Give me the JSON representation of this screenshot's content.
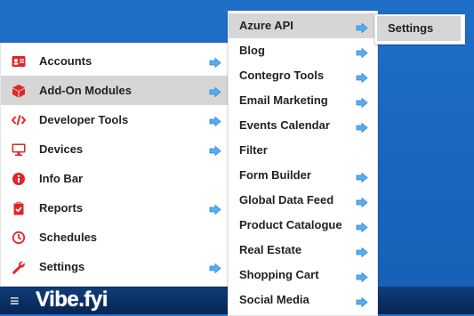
{
  "colors": {
    "desktop": "#1a64bd",
    "bar": "#0a2f63",
    "icon_red": "#e0262a",
    "arrow_blue": "#56aef0",
    "active_bg": "#d6d6d6",
    "text": "#222222"
  },
  "taskbar": {
    "menu_glyph": "≡",
    "logo": "Vibe.fyi"
  },
  "main_menu": [
    {
      "label": "Accounts",
      "icon": "id-card-icon",
      "submenu": true
    },
    {
      "label": "Add-On Modules",
      "icon": "cube-icon",
      "submenu": true,
      "active": true
    },
    {
      "label": "Developer Tools",
      "icon": "code-icon",
      "submenu": true
    },
    {
      "label": "Devices",
      "icon": "monitor-icon",
      "submenu": true
    },
    {
      "label": "Info Bar",
      "icon": "info-circle-icon",
      "submenu": false
    },
    {
      "label": "Reports",
      "icon": "clipboard-check-icon",
      "submenu": true
    },
    {
      "label": "Schedules",
      "icon": "clock-icon",
      "submenu": false
    },
    {
      "label": "Settings",
      "icon": "wrench-icon",
      "submenu": true
    }
  ],
  "addon_menu": [
    {
      "label": "Azure API",
      "submenu": true,
      "active": true
    },
    {
      "label": "Blog",
      "submenu": true
    },
    {
      "label": "Contegro Tools",
      "submenu": true
    },
    {
      "label": "Email Marketing",
      "submenu": true
    },
    {
      "label": "Events Calendar",
      "submenu": true
    },
    {
      "label": "Filter",
      "submenu": false
    },
    {
      "label": "Form Builder",
      "submenu": true
    },
    {
      "label": "Global Data Feed",
      "submenu": true
    },
    {
      "label": "Product Catalogue",
      "submenu": true
    },
    {
      "label": "Real Estate",
      "submenu": true
    },
    {
      "label": "Shopping Cart",
      "submenu": true
    },
    {
      "label": "Social Media",
      "submenu": true
    }
  ],
  "azure_menu": [
    {
      "label": "Settings",
      "active": true
    }
  ]
}
